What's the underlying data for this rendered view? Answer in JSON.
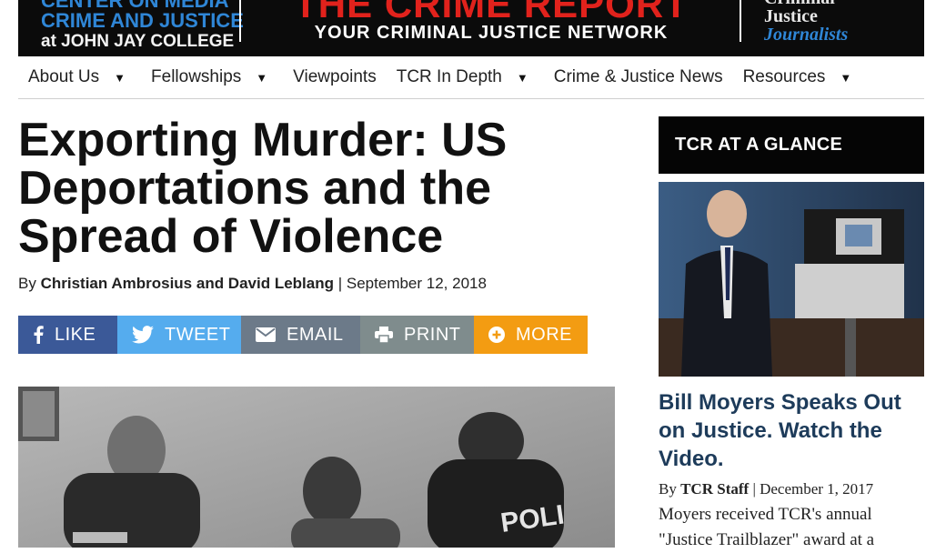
{
  "header": {
    "left_line1": "CENTER ON MEDIA",
    "left_line2": "CRIME AND JUSTICE",
    "left_line3": "at JOHN JAY COLLEGE",
    "center_title": "THE CRIME REPORT",
    "center_subtitle": "YOUR CRIMINAL JUSTICE NETWORK",
    "right_line1": "Criminal",
    "right_line2": "Justice",
    "right_line3": "Journalists",
    "colors": {
      "accent_blue": "#2f86d6",
      "brand_red": "#e1221c",
      "background": "#0b0b0b"
    }
  },
  "nav": {
    "items": [
      {
        "label": "About Us",
        "has_dropdown": true
      },
      {
        "label": "Fellowships",
        "has_dropdown": true
      },
      {
        "label": "Viewpoints",
        "has_dropdown": false
      },
      {
        "label": "TCR In Depth",
        "has_dropdown": true
      },
      {
        "label": "Crime & Justice News",
        "has_dropdown": false
      },
      {
        "label": "Resources",
        "has_dropdown": true
      }
    ],
    "caret_icon": "caret-down-icon"
  },
  "article": {
    "title": "Exporting Murder: US Deportations and the Spread of Violence",
    "by_prefix": "By",
    "authors": "Christian Ambrosius and David Leblang",
    "separator": "|",
    "date": "September 12, 2018",
    "image_alt": "police-officers-photo"
  },
  "share": {
    "like": {
      "label": "LIKE",
      "icon": "facebook-icon",
      "color": "#3b5998"
    },
    "tweet": {
      "label": "TWEET",
      "icon": "twitter-icon",
      "color": "#55acee"
    },
    "email": {
      "label": "EMAIL",
      "icon": "envelope-icon",
      "color": "#6c7a89"
    },
    "print": {
      "label": "PRINT",
      "icon": "printer-icon",
      "color": "#7f8c8d"
    },
    "more": {
      "label": "MORE",
      "icon": "plus-circle-icon",
      "color": "#f39c12"
    }
  },
  "sidebar": {
    "heading": "TCR AT A GLANCE",
    "feature_title": "Bill Moyers Speaks Out on Justice. Watch the Video.",
    "by_prefix": "By",
    "author": "TCR Staff",
    "separator": "|",
    "date": "December 1, 2017",
    "excerpt": "Moyers received TCR's annual \"Justice Trailblazer\" award at a"
  }
}
